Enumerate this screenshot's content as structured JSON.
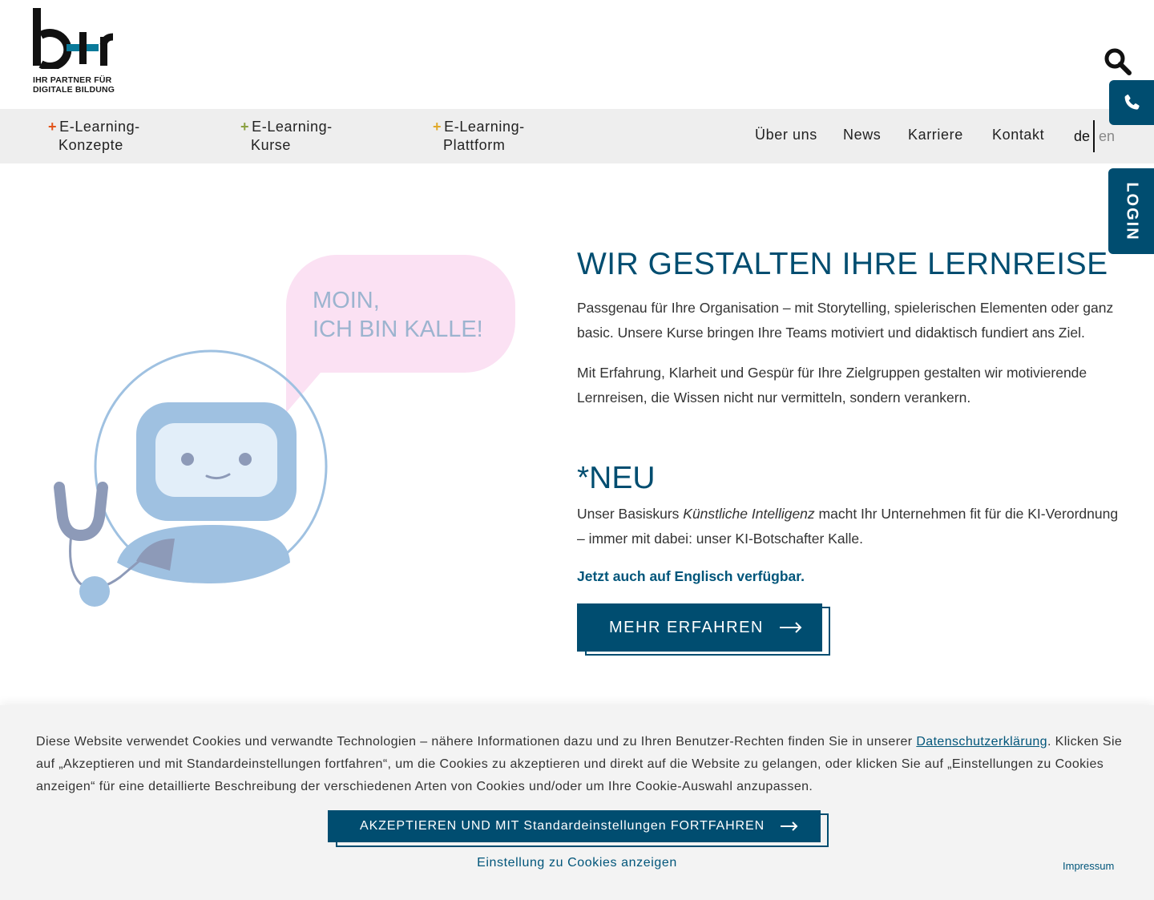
{
  "logo": {
    "tagline_line1": "IHR PARTNER FÜR",
    "tagline_line2": "DIGITALE BILDUNG"
  },
  "nav": {
    "left": [
      {
        "plus": "+",
        "line1": "E-Learning-",
        "line2": "Konzepte",
        "plus_color": "#e2541b"
      },
      {
        "plus": "+",
        "line1": "E-Learning-",
        "line2": "Kurse",
        "plus_color": "#8aa040"
      },
      {
        "plus": "+",
        "line1": "E-Learning-",
        "line2": "Plattform",
        "plus_color": "#e0a92a"
      }
    ],
    "right": [
      "Über uns",
      "News",
      "Karriere",
      "Kontakt"
    ],
    "lang_active": "de",
    "lang_other": "en"
  },
  "side": {
    "login_label": "LOGIN"
  },
  "illustration": {
    "bubble_line1": "MOIN,",
    "bubble_line2": "ICH BIN KALLE!"
  },
  "hero": {
    "title": "WIR GESTALTEN IHRE LERNREISE",
    "p1": "Passgenau für Ihre Organisation – mit Storytelling, spielerischen Elementen oder ganz basic. Unsere Kurse bringen Ihre Teams motiviert und didaktisch fundiert ans Ziel.",
    "p2": "Mit Erfahrung, Klarheit und Gespür für Ihre Zielgruppen gestalten wir motivierende Lernreisen, die Wissen nicht nur vermitteln, sondern verankern.",
    "neu_title": "*NEU",
    "neu_pre": "Unser Basiskurs ",
    "neu_em": "Künstliche Intelligenz",
    "neu_post": " macht Ihr Unternehmen fit für die KI-Verordnung – immer mit dabei: unser KI-Botschafter Kalle.",
    "highlight": "Jetzt auch auf Englisch verfügbar.",
    "button": "MEHR ERFAHREN"
  },
  "cookie": {
    "text_pre": "Diese Website verwendet Cookies und verwandte Technologien – nähere Informationen dazu und zu Ihren Benutzer-Rechten finden Sie in unserer ",
    "link": "Datenschutzerklärung",
    "text_post": ". Klicken Sie auf „Akzeptieren und mit Standardeinstellungen fortfahren“, um die Cookies zu akzeptieren und direkt auf die Website zu gelangen, oder klicken Sie auf „Einstellungen zu Cookies anzeigen“ für eine detaillierte Beschreibung der verschiedenen Arten von Cookies und/oder um Ihre Cookie-Auswahl anzupassen.",
    "accept_button": "AKZEPTIEREN UND MIT Standardeinstellungen FORTFAHREN",
    "settings_link": "Einstellung zu Cookies anzeigen",
    "impressum": "Impressum"
  },
  "colors": {
    "primary": "#004d70",
    "nav_bg": "#eeeeee",
    "cookie_bg": "#f3f3f3"
  }
}
